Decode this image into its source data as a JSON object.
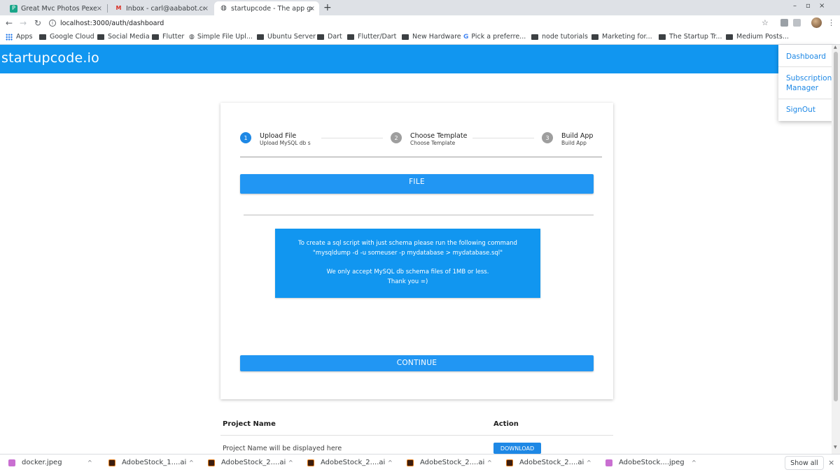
{
  "browser": {
    "tabs": [
      {
        "favicon": "P",
        "title": "Great Mvc Photos Pexels",
        "close": "×"
      },
      {
        "favicon": "M",
        "title": "Inbox - carl@aababot.com",
        "close": "×"
      },
      {
        "favicon": "◍",
        "title": "startupcode - The app gen",
        "close": "×"
      }
    ],
    "new_tab": "+",
    "window_controls": {
      "minimize": "–",
      "maximize": "▫",
      "close": "×"
    },
    "nav": {
      "back": "←",
      "forward": "→",
      "reload": "↻"
    },
    "url": "localhost:3000/auth/dashboard",
    "star": "☆",
    "menu": "⋮",
    "bookmarks": [
      {
        "label": "Apps",
        "kind": "apps"
      },
      {
        "label": "Google Cloud",
        "kind": "folder"
      },
      {
        "label": "Social Media",
        "kind": "folder"
      },
      {
        "label": "Flutter",
        "kind": "folder"
      },
      {
        "label": "Simple File Upl...",
        "kind": "globe"
      },
      {
        "label": "Ubuntu Server",
        "kind": "folder"
      },
      {
        "label": "Dart",
        "kind": "folder"
      },
      {
        "label": "Flutter/Dart",
        "kind": "folder"
      },
      {
        "label": "New Hardware",
        "kind": "folder"
      },
      {
        "label": "Pick a preferre...",
        "kind": "google"
      },
      {
        "label": "node tutorials",
        "kind": "folder"
      },
      {
        "label": "Marketing for...",
        "kind": "folder"
      },
      {
        "label": "The Startup Tr...",
        "kind": "folder"
      },
      {
        "label": "Medium Posts...",
        "kind": "folder"
      }
    ]
  },
  "app": {
    "brand": "startupcode.io",
    "accent_color": "#1196f0",
    "menu": {
      "dashboard": "Dashboard",
      "subscription_line1": "Subscription",
      "subscription_line2": "Manager",
      "signout": "SignOut"
    },
    "stepper": {
      "steps": [
        {
          "number": "1",
          "title": "Upload File",
          "subtitle": "Upload MySQL db s",
          "active": true
        },
        {
          "number": "2",
          "title": "Choose Template",
          "subtitle": "Choose Template",
          "active": false
        },
        {
          "number": "3",
          "title": "Build App",
          "subtitle": "Build App",
          "active": false
        }
      ]
    },
    "file_button": "FILE",
    "info": {
      "line1": "To create a sql script with just schema please run the following command",
      "line2": "\"mysqldump -d -u someuser -p mydatabase > mydatabase.sql\"",
      "line3": "We only accept MySQL db schema files of 1MB or less.",
      "line4": "Thank you =)"
    },
    "continue_button": "CONTINUE",
    "table": {
      "headers": {
        "project": "Project Name",
        "action": "Action"
      },
      "row": {
        "project": "Project Name will be displayed here",
        "action": "DOWNLOAD"
      }
    }
  },
  "downloads": {
    "items": [
      {
        "name": "docker.jpeg",
        "type": "jpg"
      },
      {
        "name": "AdobeStock_1....ai",
        "type": "ai"
      },
      {
        "name": "AdobeStock_2....ai",
        "type": "ai"
      },
      {
        "name": "AdobeStock_2....ai",
        "type": "ai"
      },
      {
        "name": "AdobeStock_2....ai",
        "type": "ai"
      },
      {
        "name": "AdobeStock_2....ai",
        "type": "ai"
      },
      {
        "name": "AdobeStock....jpeg",
        "type": "jpg"
      }
    ],
    "caret": "^",
    "show_all": "Show all",
    "close": "×"
  }
}
